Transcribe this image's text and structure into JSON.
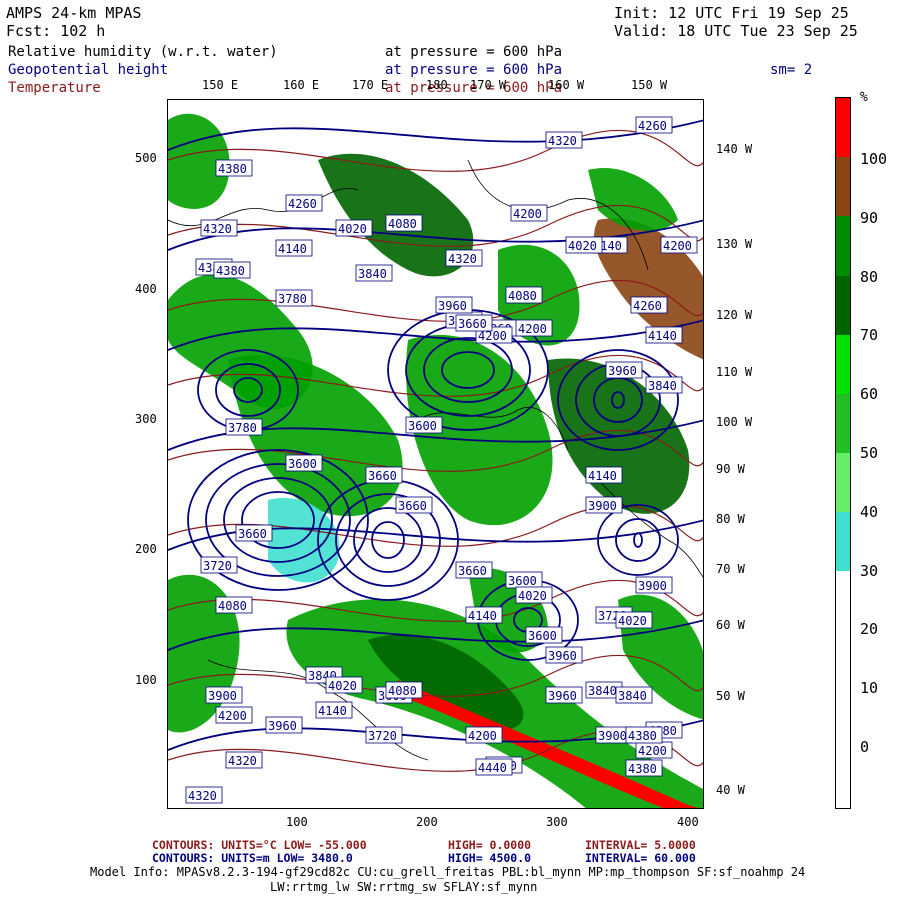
{
  "header": {
    "model": "AMPS 24-km MPAS",
    "fcst": "Fcst:  102 h",
    "init": "Init: 12 UTC Fri 19 Sep 25",
    "valid": "Valid: 18 UTC Tue 23 Sep 25",
    "field1": "Relative humidity (w.r.t. water)",
    "field2": "Geopotential height",
    "field3": "Temperature",
    "pressure_label": "at pressure =",
    "pressure_value": "600 hPa",
    "smooth": "sm= 2"
  },
  "map": {
    "top_lon_labels": [
      "150 E",
      "160 E",
      "170 E",
      "180",
      "170 W",
      "160 W",
      "150 W"
    ],
    "right_lon_labels": [
      "140 W",
      "130 W",
      "120 W",
      "110 W",
      "100 W",
      "90 W",
      "80 W",
      "70 W",
      "60 W",
      "50 W",
      "40 W"
    ],
    "left_ticks": [
      "500",
      "400",
      "300",
      "200",
      "100"
    ],
    "bottom_ticks": [
      "100",
      "200",
      "300",
      "400"
    ],
    "height_labels": [
      "4380",
      "4260",
      "4320",
      "4380",
      "4140",
      "4020",
      "4080",
      "4200",
      "4380",
      "4320",
      "4140",
      "4200",
      "3900",
      "3960",
      "4260",
      "4200",
      "4200",
      "3840",
      "3780",
      "3780",
      "3660",
      "3600",
      "3600",
      "3660",
      "3660",
      "3660",
      "3720",
      "4080",
      "3840",
      "3600",
      "3720",
      "3960",
      "3780",
      "3660",
      "3600",
      "3600",
      "3720",
      "3840",
      "3960",
      "3840",
      "4080",
      "3900",
      "4020",
      "3960",
      "4020",
      "4140",
      "4080",
      "4140",
      "4200",
      "3900",
      "3840",
      "3960",
      "4140",
      "4020",
      "3960",
      "4080",
      "3900",
      "3900",
      "4200",
      "4320",
      "4140",
      "4020",
      "4200",
      "4380",
      "4320",
      "4440",
      "4380",
      "4320",
      "4260"
    ],
    "colors": {
      "rh_green": "#00a000",
      "rh_darkgreen": "#006400",
      "rh_brown": "#8b4513",
      "rh_cyan": "#40e0d0",
      "height_contour": "#000080",
      "temp_contour": "#8b1a1a",
      "coast": "#000000"
    }
  },
  "colorbar": {
    "unit": "%",
    "labels": [
      "100",
      "90",
      "80",
      "70",
      "60",
      "50",
      "40",
      "30",
      "20",
      "10",
      "0"
    ],
    "colors": [
      "#ff0000",
      "#8b4513",
      "#008c00",
      "#006400",
      "#00e000",
      "#22c022",
      "#66ee66",
      "#40e0d0",
      "#ffffff",
      "#ffffff",
      "#ffffff"
    ]
  },
  "footer": {
    "line1_a": "CONTOURS:  UNITS=°C  LOW= -55.000",
    "line1_b": "HIGH=  0.0000",
    "line1_c": "INTERVAL=   5.0000",
    "line2_a": "CONTOURS:  UNITS=m  LOW=  3480.0",
    "line2_b": "HIGH=  4500.0",
    "line2_c": "INTERVAL=   60.000",
    "info1": "Model Info: MPASv8.2.3-194-gf29cd82c CU:cu_grell_freitas PBL:bl_mynn MP:mp_thompson SF:sf_noahmp 24",
    "info2": "LW:rrtmg_lw SW:rrtmg_sw SFLAY:sf_mynn"
  }
}
